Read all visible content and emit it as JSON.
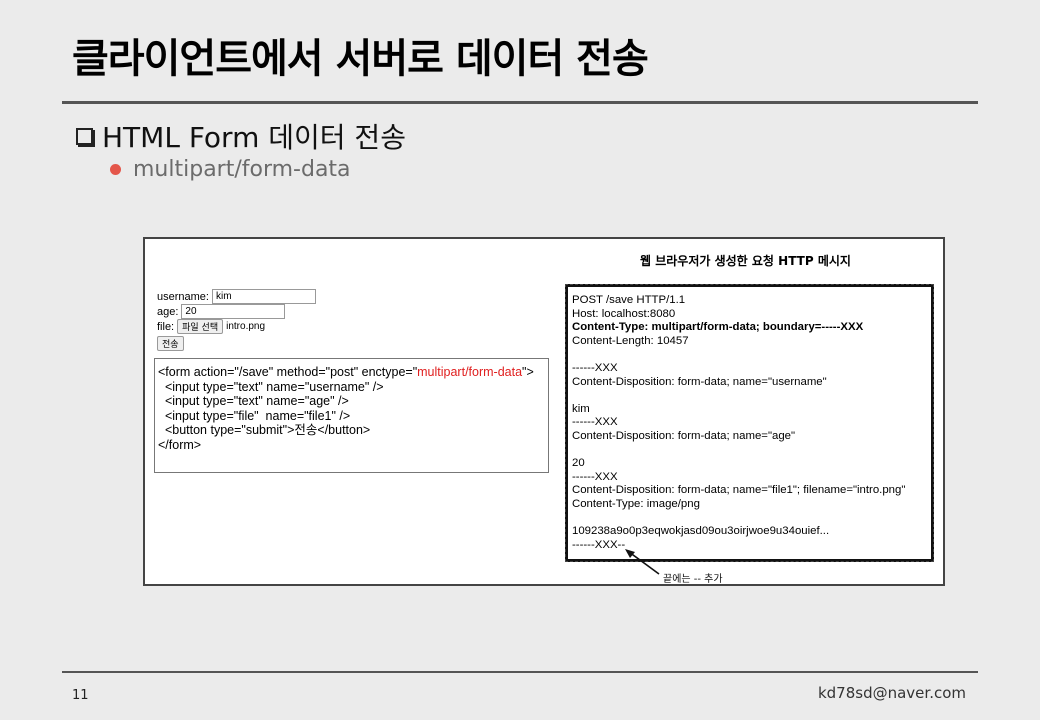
{
  "slide": {
    "title": "클라이언트에서 서버로 데이터 전송",
    "section": "HTML Form 데이터 전송",
    "bullet": "multipart/form-data",
    "page_number": "11",
    "email": "kd78sd@naver.com"
  },
  "form_demo": {
    "username_label": "username:",
    "username_value": "kim",
    "age_label": "age:",
    "age_value": "20",
    "file_label": "file:",
    "file_button": "파일 선택",
    "file_name": "intro.png",
    "submit_label": "전송"
  },
  "code": {
    "line1_pre": "<form action=\"/save\" method=\"post\" enctype=\"",
    "line1_red": "multipart/form-data",
    "line1_post": "\">",
    "line2": "  <input type=\"text\" name=\"username\" />",
    "line3": "  <input type=\"text\" name=\"age\" />",
    "line4": "  <input type=\"file\"  name=\"file1\" />",
    "line5": "  <button type=\"submit\">전송</button>",
    "line6": "</form>"
  },
  "http": {
    "caption": "웹 브라우저가 생성한 요청 HTTP 메시지",
    "lines": [
      {
        "text": "POST /save HTTP/1.1",
        "bold": false
      },
      {
        "text": "Host: localhost:8080",
        "bold": false
      },
      {
        "text": "Content-Type: multipart/form-data; boundary=-----XXX",
        "bold": true
      },
      {
        "text": "Content-Length: 10457",
        "bold": false
      },
      {
        "text": "",
        "bold": false
      },
      {
        "text": "------XXX",
        "bold": false
      },
      {
        "text": "Content-Disposition: form-data; name=\"username\"",
        "bold": false
      },
      {
        "text": "",
        "bold": false
      },
      {
        "text": "kim",
        "bold": false
      },
      {
        "text": "------XXX",
        "bold": false
      },
      {
        "text": "Content-Disposition: form-data; name=\"age\"",
        "bold": false
      },
      {
        "text": "",
        "bold": false
      },
      {
        "text": "20",
        "bold": false
      },
      {
        "text": "------XXX",
        "bold": false
      },
      {
        "text": "Content-Disposition: form-data; name=\"file1\"; filename=\"intro.png\"",
        "bold": false
      },
      {
        "text": "Content-Type: image/png",
        "bold": false
      },
      {
        "text": "",
        "bold": false
      },
      {
        "text": "109238a9o0p3eqwokjasd09ou3oirjwoe9u34ouief...",
        "bold": false
      },
      {
        "text": "------XXX--",
        "bold": false
      }
    ],
    "annotation": "끝에는 -- 추가"
  },
  "colors": {
    "accent_red": "#e02020",
    "bullet_dot": "#e4564a"
  }
}
